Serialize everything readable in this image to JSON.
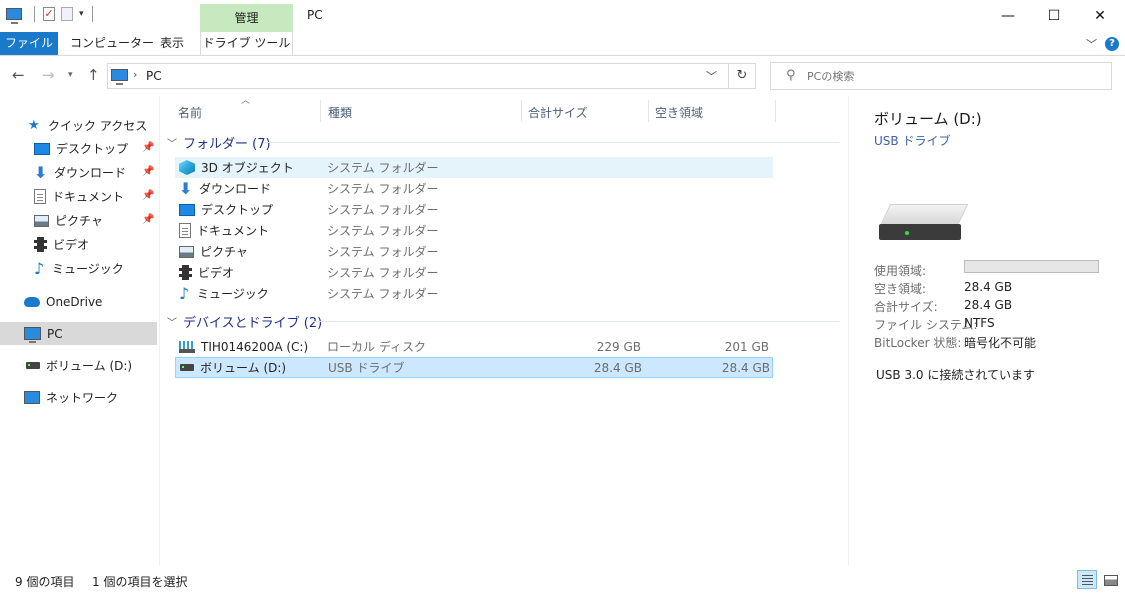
{
  "window": {
    "title": "PC",
    "context_tab": "管理",
    "controls": {
      "minimize": "—",
      "maximize": "☐",
      "close": "✕"
    }
  },
  "ribbon": {
    "tabs": [
      {
        "label": "ファイル"
      },
      {
        "label": "コンピューター"
      },
      {
        "label": "表示"
      },
      {
        "label": "ドライブ ツール"
      }
    ],
    "help": "?",
    "accent_color": "#1979ca"
  },
  "address": {
    "path": "PC",
    "search_placeholder": "PCの検索"
  },
  "nav_pane": {
    "quick_access": {
      "label": "クイック アクセス",
      "items": [
        {
          "label": "デスクトップ",
          "icon": "desktop-icon",
          "pinned": true
        },
        {
          "label": "ダウンロード",
          "icon": "download-icon",
          "pinned": true
        },
        {
          "label": "ドキュメント",
          "icon": "document-icon",
          "pinned": true
        },
        {
          "label": "ピクチャ",
          "icon": "pictures-icon",
          "pinned": true
        },
        {
          "label": "ビデオ",
          "icon": "video-icon",
          "pinned": false
        },
        {
          "label": "ミュージック",
          "icon": "music-icon",
          "pinned": false
        }
      ]
    },
    "onedrive": "OneDrive",
    "pc": "PC",
    "volume": "ボリューム (D:)",
    "network": "ネットワーク"
  },
  "file_list": {
    "columns": {
      "name": "名前",
      "type": "種類",
      "total": "合計サイズ",
      "free": "空き領域"
    },
    "groups": [
      {
        "label": "フォルダー (7)",
        "rows": [
          {
            "name": "3D オブジェクト",
            "type": "システム フォルダー",
            "icon": "3d-objects-icon",
            "total": "",
            "free": ""
          },
          {
            "name": "ダウンロード",
            "type": "システム フォルダー",
            "icon": "download-icon",
            "total": "",
            "free": ""
          },
          {
            "name": "デスクトップ",
            "type": "システム フォルダー",
            "icon": "desktop-icon",
            "total": "",
            "free": ""
          },
          {
            "name": "ドキュメント",
            "type": "システム フォルダー",
            "icon": "document-icon",
            "total": "",
            "free": ""
          },
          {
            "name": "ピクチャ",
            "type": "システム フォルダー",
            "icon": "pictures-icon",
            "total": "",
            "free": ""
          },
          {
            "name": "ビデオ",
            "type": "システム フォルダー",
            "icon": "video-icon",
            "total": "",
            "free": ""
          },
          {
            "name": "ミュージック",
            "type": "システム フォルダー",
            "icon": "music-icon",
            "total": "",
            "free": ""
          }
        ]
      },
      {
        "label": "デバイスとドライブ (2)",
        "rows": [
          {
            "name": "TIH0146200A (C:)",
            "type": "ローカル ディスク",
            "icon": "hard-drive-icon",
            "total": "229 GB",
            "free": "201 GB"
          },
          {
            "name": "ボリューム (D:)",
            "type": "USB ドライブ",
            "icon": "usb-drive-icon",
            "total": "28.4 GB",
            "free": "28.4 GB"
          }
        ]
      }
    ]
  },
  "details": {
    "title": "ボリューム (D:)",
    "subtitle": "USB ドライブ",
    "used_label": "使用領域:",
    "used_fraction": 0.0,
    "props": [
      {
        "label": "空き領域:",
        "value": "28.4 GB"
      },
      {
        "label": "合計サイズ:",
        "value": "28.4 GB"
      },
      {
        "label": "ファイル システム:",
        "value": "NTFS"
      },
      {
        "label": "BitLocker 状態:",
        "value": "暗号化不可能"
      }
    ],
    "note": "USB 3.0 に接続されています"
  },
  "status": {
    "item_count": "9 個の項目",
    "selected": "1 個の項目を選択"
  }
}
